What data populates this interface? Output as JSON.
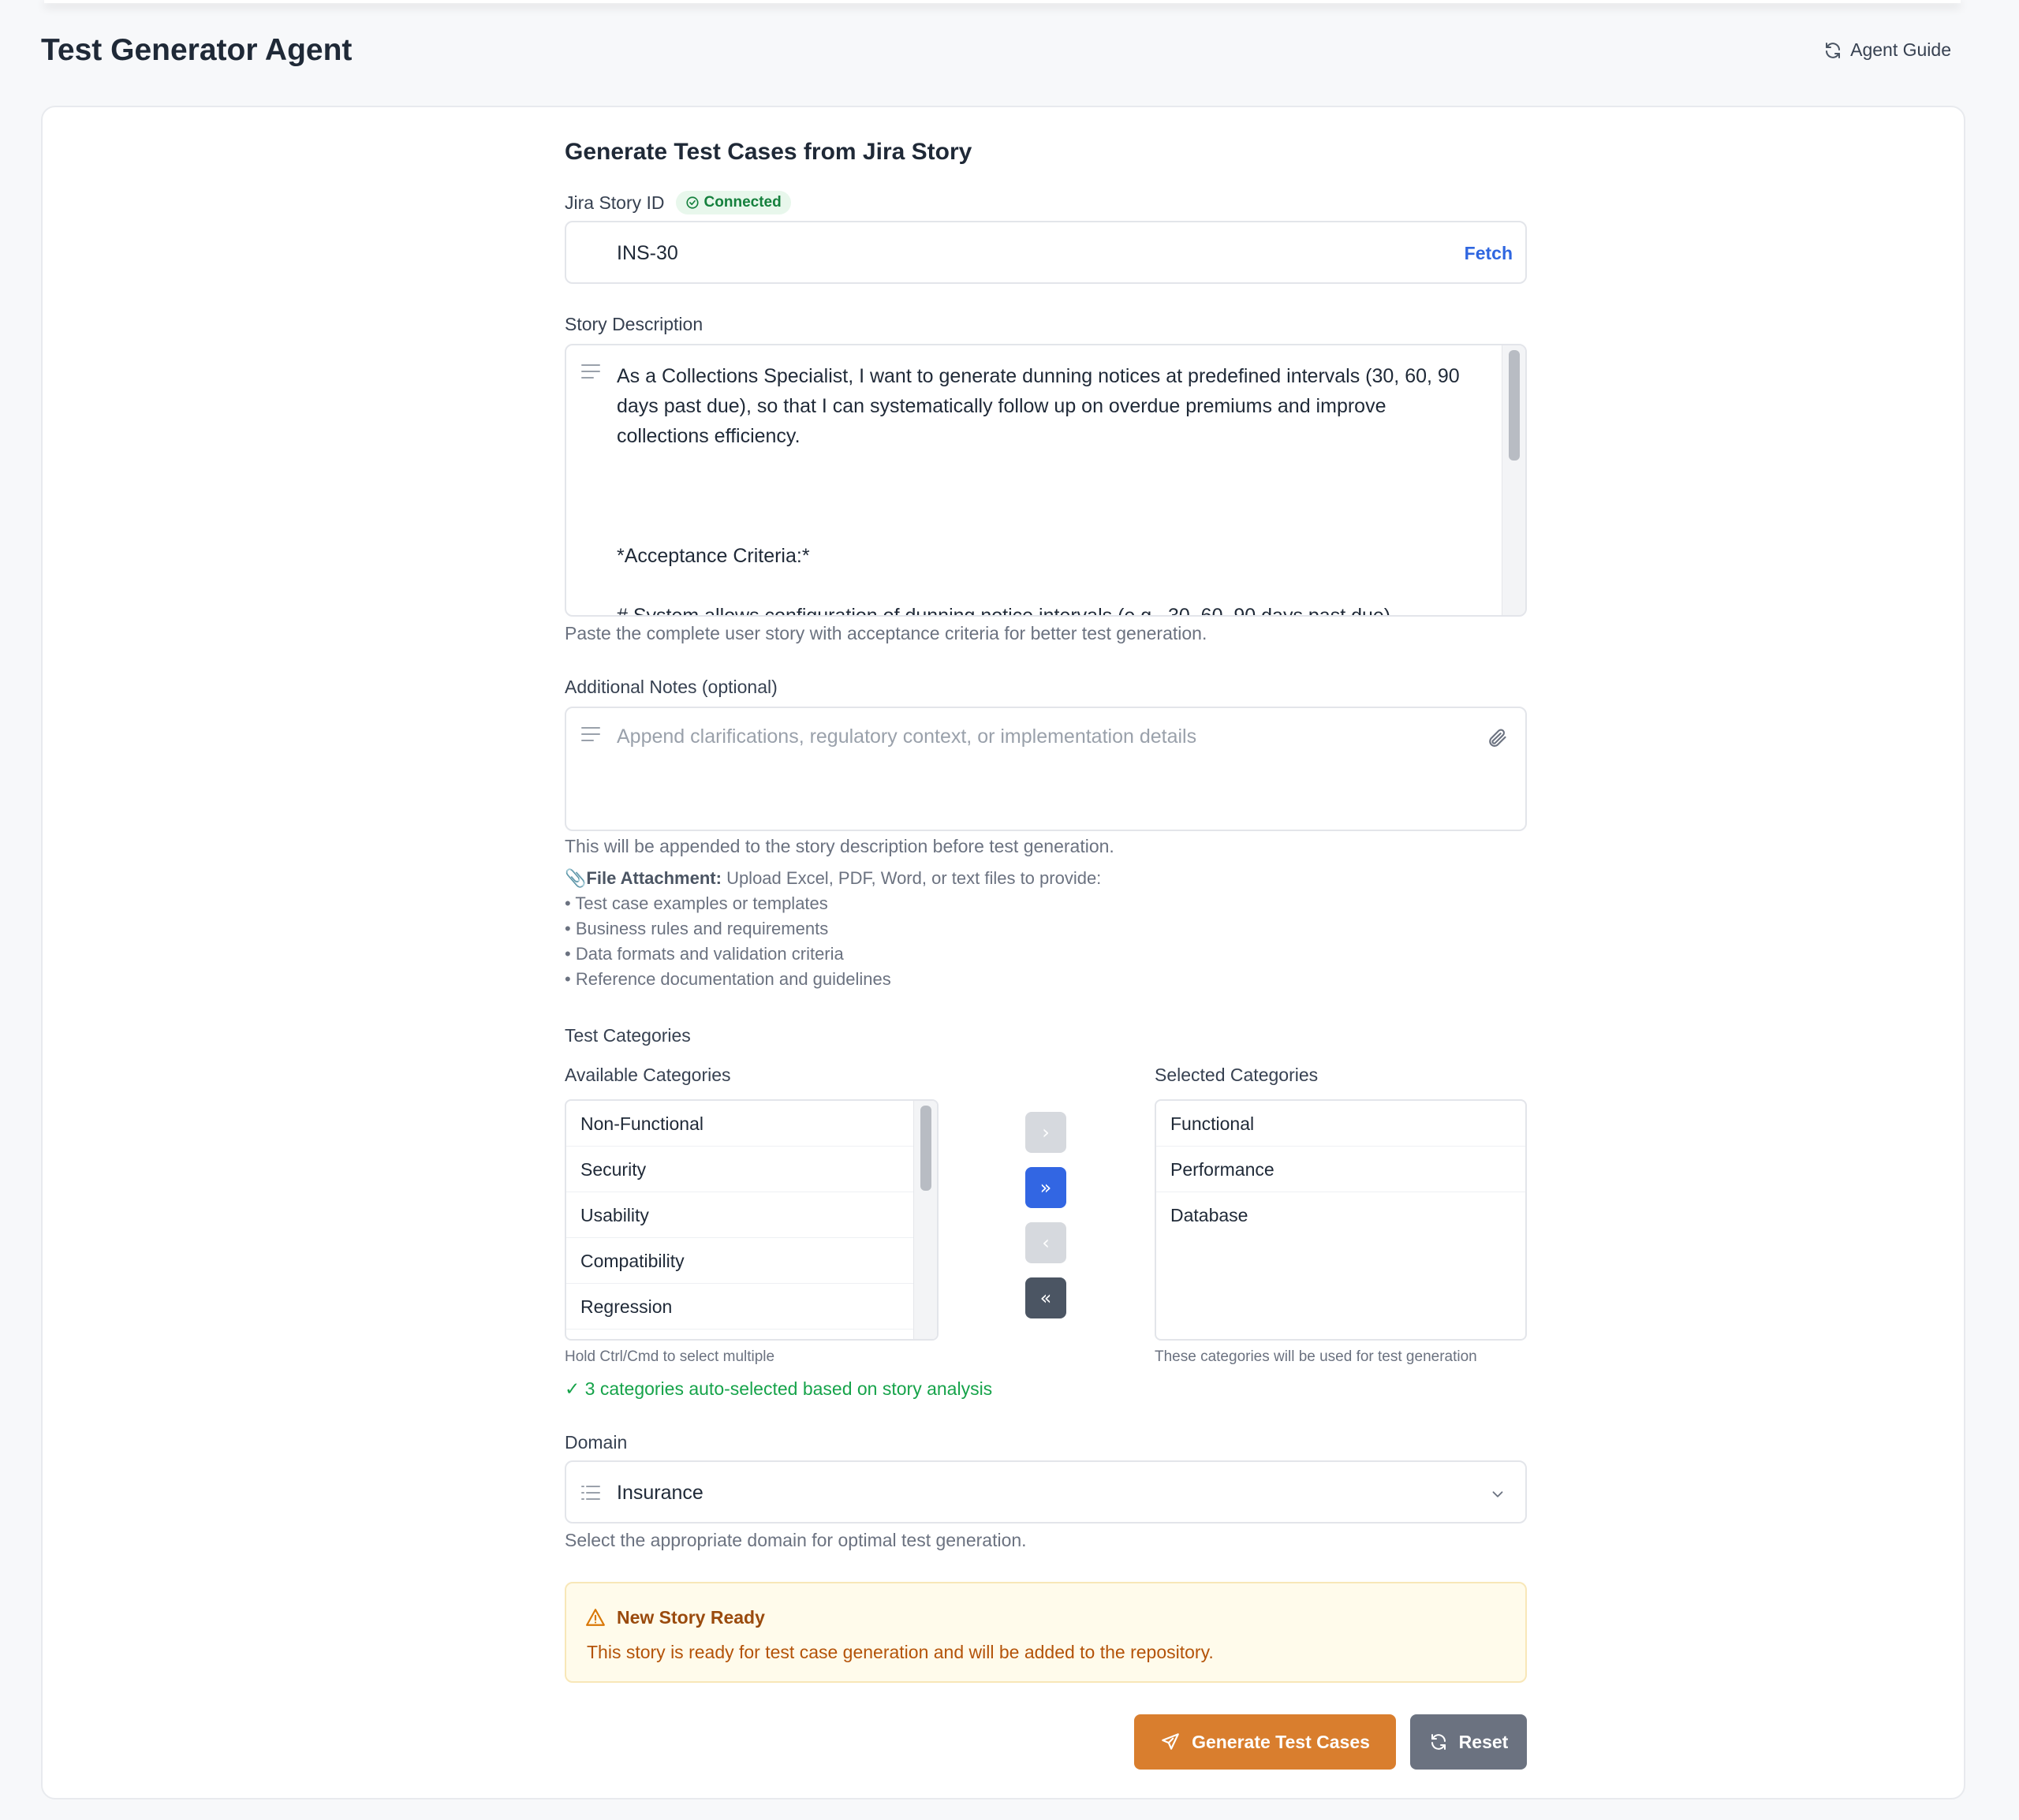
{
  "app": {
    "title": "Test Generator Agent",
    "agent_guide_label": "Agent Guide"
  },
  "form": {
    "section_title": "Generate Test Cases from Jira Story",
    "jira": {
      "label": "Jira Story ID",
      "status_badge": "Connected",
      "value": "INS-30",
      "fetch_label": "Fetch"
    },
    "story": {
      "label": "Story Description",
      "value": "As a Collections Specialist, I want to generate dunning notices at predefined intervals (30, 60, 90 days past due), so that I can systematically follow up on overdue premiums and improve collections efficiency.\n\n\n\n*Acceptance Criteria:*\n\n# System allows configuration of dunning notice intervals (e.g., 30, 60, 90 days past due).",
      "helper": "Paste the complete user story with acceptance criteria for better test generation."
    },
    "notes": {
      "label": "Additional Notes (optional)",
      "placeholder": "Append clarifications, regulatory context, or implementation details",
      "helper": "This will be appended to the story description before test generation."
    },
    "file_attachment": {
      "icon": "📎",
      "title": "File Attachment:",
      "intro": "Upload Excel, PDF, Word, or text files to provide:",
      "items": [
        "• Test case examples or templates",
        "• Business rules and requirements",
        "• Data formats and validation criteria",
        "• Reference documentation and guidelines"
      ]
    },
    "categories": {
      "label": "Test Categories",
      "available_label": "Available Categories",
      "selected_label": "Selected Categories",
      "available": [
        "Non-Functional",
        "Security",
        "Usability",
        "Compatibility",
        "Regression"
      ],
      "selected": [
        "Functional",
        "Performance",
        "Database"
      ],
      "available_helper": "Hold Ctrl/Cmd to select multiple",
      "selected_helper": "These categories will be used for test generation",
      "auto_selected_msg": "✓ 3 categories auto-selected based on story analysis",
      "buttons": {
        "move_right": "›",
        "move_all_right": "»",
        "move_left": "‹",
        "move_all_left": "«"
      }
    },
    "domain": {
      "label": "Domain",
      "value": "Insurance",
      "helper": "Select the appropriate domain for optimal test generation."
    },
    "alert": {
      "title": "New Story Ready",
      "body": "This story is ready for test case generation and will be added to the repository."
    },
    "actions": {
      "generate_label": "Generate Test Cases",
      "reset_label": "Reset"
    }
  },
  "colors": {
    "accent_blue": "#3266e3",
    "generate_orange": "#d97e2e",
    "success_green": "#15803d",
    "warning_bg": "#fffbeb"
  }
}
